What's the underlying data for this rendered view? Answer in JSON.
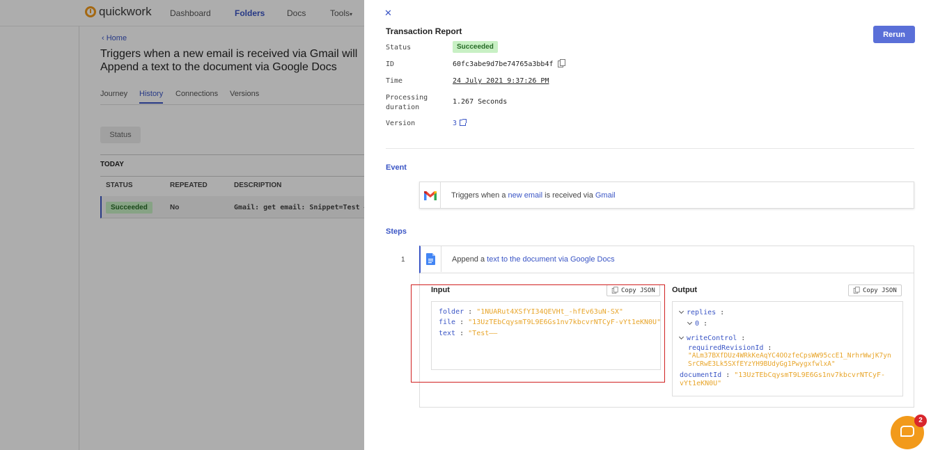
{
  "nav": {
    "logo_text": "quickwork",
    "items": [
      "Dashboard",
      "Folders",
      "Docs",
      "Tools"
    ]
  },
  "background": {
    "breadcrumb": "Home",
    "title": "Triggers when a new email is received via Gmail will Append a text to the document via Google Docs",
    "tabs": [
      "Journey",
      "History",
      "Connections",
      "Versions"
    ],
    "filter_label": "Status",
    "group_label": "TODAY",
    "columns": [
      "STATUS",
      "REPEATED",
      "DESCRIPTION"
    ],
    "row": {
      "status": "Succeeded",
      "repeated": "No",
      "description": "Gmail: get email: Snippet=Test —"
    }
  },
  "report": {
    "title": "Transaction Report",
    "rerun_label": "Rerun",
    "fields": {
      "status_label": "Status",
      "status_value": "Succeeded",
      "id_label": "ID",
      "id_value": "60fc3abe9d7be74765a3bb4f",
      "time_label": "Time",
      "time_value": "24 July 2021 9:37:26 PM",
      "duration_label_1": "Processing",
      "duration_label_2": "duration",
      "duration_value": "1.267 Seconds",
      "version_label": "Version",
      "version_value": "3"
    },
    "event": {
      "section_label": "Event",
      "text_prefix": "Triggers when a ",
      "text_link1": "new email",
      "text_middle": " is received via ",
      "text_link2": "Gmail"
    },
    "steps": {
      "section_label": "Steps",
      "number": "1",
      "text_prefix": "Append a ",
      "text_link": "text to the document via Google Docs"
    },
    "input": {
      "title": "Input",
      "copy_label": "Copy JSON",
      "lines": [
        {
          "key": "folder",
          "value": "\"1NUARut4XSfYI34QEVHt_-hfEv63uN-SX\""
        },
        {
          "key": "file",
          "value": "\"13UzTEbCqysmT9L9E6Gs1nv7kbcvrNTCyF-vYt1eKN0U\""
        },
        {
          "key": "text",
          "value": "\"Test——"
        }
      ]
    },
    "output": {
      "title": "Output",
      "copy_label": "Copy JSON",
      "replies_key": "replies",
      "index_key": "0",
      "write_control_key": "writeControl",
      "revision_key": "requiredRevisionId",
      "revision_value_1": "\"ALm37BXfDUz4WRkKeAqYC4OOzfeCpsWW95ccE1_NrhrWwjK7yn",
      "revision_value_2": "SrCRwE3Lk5SXfEYzYH9BUdyGg1PwygxfwlxA\"",
      "document_key": "documentId",
      "document_value_1": "\"13UzTEbCqysmT9L9E6Gs1nv7kbcvrNTCyF-",
      "document_value_2": "vYt1eKN0U\""
    }
  },
  "chat": {
    "badge_count": "2"
  },
  "colors": {
    "accent": "#3a55c5",
    "success_bg": "#c8f0c4",
    "json_value": "#e8a52a",
    "brand": "#f29a1b"
  }
}
